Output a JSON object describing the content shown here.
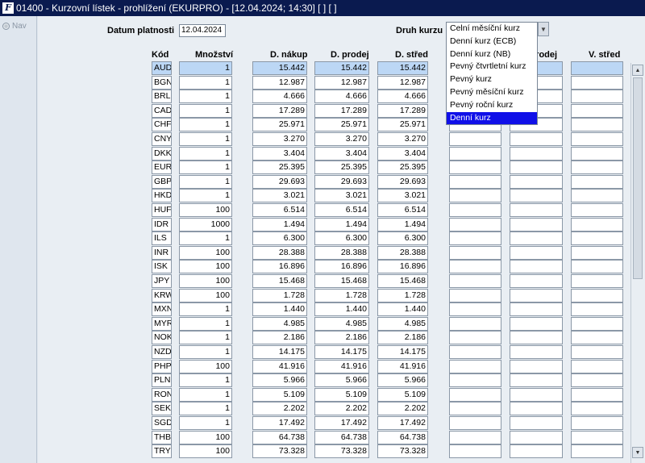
{
  "window": {
    "app_icon": "F",
    "title": "01400 - Kurzovní lístek - prohlížení (EKURPRO) - [12.04.2024; 14:30]  [ ]  [ ]"
  },
  "nav": {
    "label": "Nav"
  },
  "form": {
    "date_label": "Datum platnosti",
    "date_value": "12.04.2024",
    "rate_type_label": "Druh kurzu"
  },
  "columns": {
    "code": "Kód",
    "amount": "Množství",
    "buy": "D. nákup",
    "sell": "D. prodej",
    "mid": "D. střed",
    "e_sell": "V. prodej",
    "e_mid": "V. střed"
  },
  "dropdown": {
    "options": [
      "Celní měsíční kurz",
      "Denní kurz (ECB)",
      "Denní kurz (NB)",
      "Pevný čtvrtletní kurz",
      "Pevný kurz",
      "Pevný měsíční kurz",
      "Pevný roční kurz",
      "Denní kurz"
    ],
    "selected_index": 7
  },
  "rows": [
    [
      "AUD",
      "1",
      "15.442",
      "15.442",
      "15.442"
    ],
    [
      "BGN",
      "1",
      "12.987",
      "12.987",
      "12.987"
    ],
    [
      "BRL",
      "1",
      "4.666",
      "4.666",
      "4.666"
    ],
    [
      "CAD",
      "1",
      "17.289",
      "17.289",
      "17.289"
    ],
    [
      "CHF",
      "1",
      "25.971",
      "25.971",
      "25.971"
    ],
    [
      "CNY",
      "1",
      "3.270",
      "3.270",
      "3.270"
    ],
    [
      "DKK",
      "1",
      "3.404",
      "3.404",
      "3.404"
    ],
    [
      "EUR",
      "1",
      "25.395",
      "25.395",
      "25.395"
    ],
    [
      "GBP",
      "1",
      "29.693",
      "29.693",
      "29.693"
    ],
    [
      "HKD",
      "1",
      "3.021",
      "3.021",
      "3.021"
    ],
    [
      "HUF",
      "100",
      "6.514",
      "6.514",
      "6.514"
    ],
    [
      "IDR",
      "1000",
      "1.494",
      "1.494",
      "1.494"
    ],
    [
      "ILS",
      "1",
      "6.300",
      "6.300",
      "6.300"
    ],
    [
      "INR",
      "100",
      "28.388",
      "28.388",
      "28.388"
    ],
    [
      "ISK",
      "100",
      "16.896",
      "16.896",
      "16.896"
    ],
    [
      "JPY",
      "100",
      "15.468",
      "15.468",
      "15.468"
    ],
    [
      "KRW",
      "100",
      "1.728",
      "1.728",
      "1.728"
    ],
    [
      "MXN",
      "1",
      "1.440",
      "1.440",
      "1.440"
    ],
    [
      "MYR",
      "1",
      "4.985",
      "4.985",
      "4.985"
    ],
    [
      "NOK",
      "1",
      "2.186",
      "2.186",
      "2.186"
    ],
    [
      "NZD",
      "1",
      "14.175",
      "14.175",
      "14.175"
    ],
    [
      "PHP",
      "100",
      "41.916",
      "41.916",
      "41.916"
    ],
    [
      "PLN",
      "1",
      "5.966",
      "5.966",
      "5.966"
    ],
    [
      "RON",
      "1",
      "5.109",
      "5.109",
      "5.109"
    ],
    [
      "SEK",
      "1",
      "2.202",
      "2.202",
      "2.202"
    ],
    [
      "SGD",
      "1",
      "17.492",
      "17.492",
      "17.492"
    ],
    [
      "THB",
      "100",
      "64.738",
      "64.738",
      "64.738"
    ],
    [
      "TRY",
      "100",
      "73.328",
      "73.328",
      "73.328"
    ]
  ],
  "selected_row": 0,
  "colors": {
    "titlebar": "#0a1a4f",
    "selected_row": "#bcd7f5",
    "dropdown_highlight": "#1010e8"
  }
}
